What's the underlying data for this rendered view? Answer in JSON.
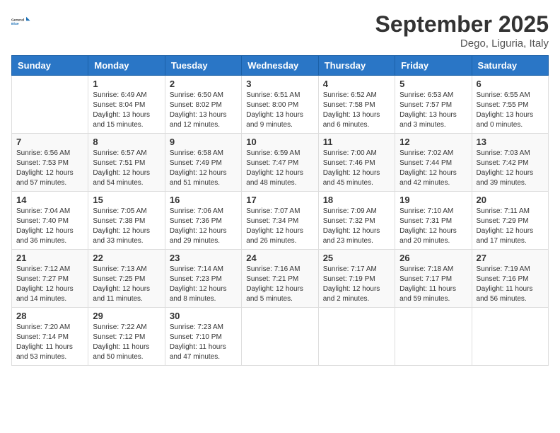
{
  "header": {
    "logo_line1": "General",
    "logo_line2": "Blue",
    "month": "September 2025",
    "location": "Dego, Liguria, Italy"
  },
  "weekdays": [
    "Sunday",
    "Monday",
    "Tuesday",
    "Wednesday",
    "Thursday",
    "Friday",
    "Saturday"
  ],
  "weeks": [
    [
      {
        "day": "",
        "info": ""
      },
      {
        "day": "1",
        "info": "Sunrise: 6:49 AM\nSunset: 8:04 PM\nDaylight: 13 hours\nand 15 minutes."
      },
      {
        "day": "2",
        "info": "Sunrise: 6:50 AM\nSunset: 8:02 PM\nDaylight: 13 hours\nand 12 minutes."
      },
      {
        "day": "3",
        "info": "Sunrise: 6:51 AM\nSunset: 8:00 PM\nDaylight: 13 hours\nand 9 minutes."
      },
      {
        "day": "4",
        "info": "Sunrise: 6:52 AM\nSunset: 7:58 PM\nDaylight: 13 hours\nand 6 minutes."
      },
      {
        "day": "5",
        "info": "Sunrise: 6:53 AM\nSunset: 7:57 PM\nDaylight: 13 hours\nand 3 minutes."
      },
      {
        "day": "6",
        "info": "Sunrise: 6:55 AM\nSunset: 7:55 PM\nDaylight: 13 hours\nand 0 minutes."
      }
    ],
    [
      {
        "day": "7",
        "info": "Sunrise: 6:56 AM\nSunset: 7:53 PM\nDaylight: 12 hours\nand 57 minutes."
      },
      {
        "day": "8",
        "info": "Sunrise: 6:57 AM\nSunset: 7:51 PM\nDaylight: 12 hours\nand 54 minutes."
      },
      {
        "day": "9",
        "info": "Sunrise: 6:58 AM\nSunset: 7:49 PM\nDaylight: 12 hours\nand 51 minutes."
      },
      {
        "day": "10",
        "info": "Sunrise: 6:59 AM\nSunset: 7:47 PM\nDaylight: 12 hours\nand 48 minutes."
      },
      {
        "day": "11",
        "info": "Sunrise: 7:00 AM\nSunset: 7:46 PM\nDaylight: 12 hours\nand 45 minutes."
      },
      {
        "day": "12",
        "info": "Sunrise: 7:02 AM\nSunset: 7:44 PM\nDaylight: 12 hours\nand 42 minutes."
      },
      {
        "day": "13",
        "info": "Sunrise: 7:03 AM\nSunset: 7:42 PM\nDaylight: 12 hours\nand 39 minutes."
      }
    ],
    [
      {
        "day": "14",
        "info": "Sunrise: 7:04 AM\nSunset: 7:40 PM\nDaylight: 12 hours\nand 36 minutes."
      },
      {
        "day": "15",
        "info": "Sunrise: 7:05 AM\nSunset: 7:38 PM\nDaylight: 12 hours\nand 33 minutes."
      },
      {
        "day": "16",
        "info": "Sunrise: 7:06 AM\nSunset: 7:36 PM\nDaylight: 12 hours\nand 29 minutes."
      },
      {
        "day": "17",
        "info": "Sunrise: 7:07 AM\nSunset: 7:34 PM\nDaylight: 12 hours\nand 26 minutes."
      },
      {
        "day": "18",
        "info": "Sunrise: 7:09 AM\nSunset: 7:32 PM\nDaylight: 12 hours\nand 23 minutes."
      },
      {
        "day": "19",
        "info": "Sunrise: 7:10 AM\nSunset: 7:31 PM\nDaylight: 12 hours\nand 20 minutes."
      },
      {
        "day": "20",
        "info": "Sunrise: 7:11 AM\nSunset: 7:29 PM\nDaylight: 12 hours\nand 17 minutes."
      }
    ],
    [
      {
        "day": "21",
        "info": "Sunrise: 7:12 AM\nSunset: 7:27 PM\nDaylight: 12 hours\nand 14 minutes."
      },
      {
        "day": "22",
        "info": "Sunrise: 7:13 AM\nSunset: 7:25 PM\nDaylight: 12 hours\nand 11 minutes."
      },
      {
        "day": "23",
        "info": "Sunrise: 7:14 AM\nSunset: 7:23 PM\nDaylight: 12 hours\nand 8 minutes."
      },
      {
        "day": "24",
        "info": "Sunrise: 7:16 AM\nSunset: 7:21 PM\nDaylight: 12 hours\nand 5 minutes."
      },
      {
        "day": "25",
        "info": "Sunrise: 7:17 AM\nSunset: 7:19 PM\nDaylight: 12 hours\nand 2 minutes."
      },
      {
        "day": "26",
        "info": "Sunrise: 7:18 AM\nSunset: 7:17 PM\nDaylight: 11 hours\nand 59 minutes."
      },
      {
        "day": "27",
        "info": "Sunrise: 7:19 AM\nSunset: 7:16 PM\nDaylight: 11 hours\nand 56 minutes."
      }
    ],
    [
      {
        "day": "28",
        "info": "Sunrise: 7:20 AM\nSunset: 7:14 PM\nDaylight: 11 hours\nand 53 minutes."
      },
      {
        "day": "29",
        "info": "Sunrise: 7:22 AM\nSunset: 7:12 PM\nDaylight: 11 hours\nand 50 minutes."
      },
      {
        "day": "30",
        "info": "Sunrise: 7:23 AM\nSunset: 7:10 PM\nDaylight: 11 hours\nand 47 minutes."
      },
      {
        "day": "",
        "info": ""
      },
      {
        "day": "",
        "info": ""
      },
      {
        "day": "",
        "info": ""
      },
      {
        "day": "",
        "info": ""
      }
    ]
  ]
}
